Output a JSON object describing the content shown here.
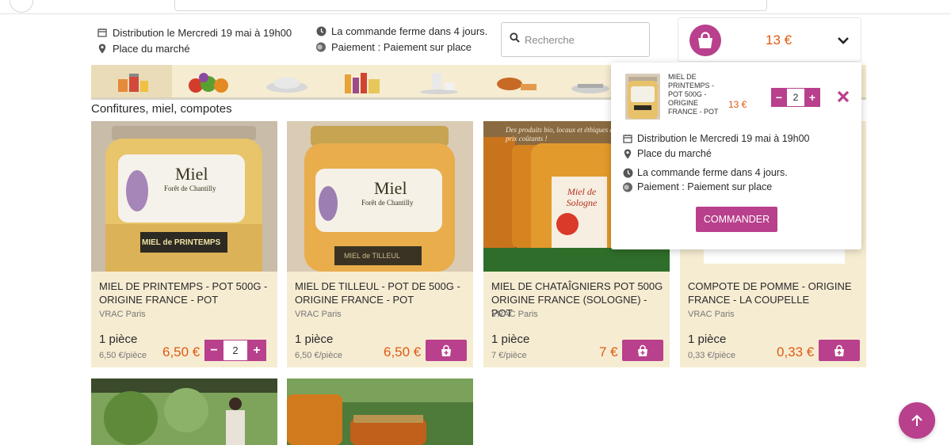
{
  "header": {
    "distribution": "Distribution le Mercredi 19 mai à 19h00",
    "place": "Place du marché",
    "closing": "La commande ferme dans 4 jours.",
    "payment": "Paiement : Paiement sur place"
  },
  "search": {
    "placeholder": "Recherche"
  },
  "cart": {
    "total": "13 €",
    "item": {
      "name": "MIEL DE PRINTEMPS - POT 500G - ORIGINE FRANCE - POT",
      "price": "13 €",
      "qty": "2"
    },
    "distribution": "Distribution le Mercredi 19 mai à 19h00",
    "place": "Place du marché",
    "closing": "La commande ferme dans 4 jours.",
    "payment": "Paiement : Paiement sur place",
    "order_label": "COMMANDER"
  },
  "categories": [
    {
      "icon": "jars-icon"
    },
    {
      "icon": "vegetables-icon"
    },
    {
      "icon": "dishes-icon"
    },
    {
      "icon": "bottles-icon"
    },
    {
      "icon": "dairy-icon"
    },
    {
      "icon": "bread-icon"
    },
    {
      "icon": "kitchen-icon"
    }
  ],
  "section_title": "Confitures, miel, compotes",
  "products": [
    {
      "name": "MIEL DE PRINTEMPS - POT 500G - ORIGINE FRANCE - POT",
      "vendor": "VRAC Paris",
      "unit": "1 pièce",
      "unit_price": "6,50 €/pièce",
      "price": "6,50 €",
      "qty": "2",
      "image_label": "Miel",
      "image_sub": "Forêt de Chantilly",
      "image_band": "MIEL de PRINTEMPS"
    },
    {
      "name": "MIEL DE TILLEUL - POT DE 500G - ORIGINE FRANCE - POT",
      "vendor": "VRAC Paris",
      "unit": "1 pièce",
      "unit_price": "6,50 €/pièce",
      "price": "6,50 €",
      "image_label": "Miel",
      "image_sub": "Forêt de Chantilly",
      "image_band": "MIEL de TILLEUL"
    },
    {
      "name": "MIEL DE CHATAÎGNIERS POT 500G ORIGINE FRANCE (SOLOGNE) - POT",
      "vendor": "VRAC Paris",
      "unit": "1 pièce",
      "unit_price": "7 €/pièce",
      "price": "7 €",
      "image_label": "Miel de Sologne",
      "image_tag": "Des produits bio, locaux et éthiques à prix coûtants !"
    },
    {
      "name": "COMPOTE DE POMME - ORIGINE FRANCE - LA COUPELLE",
      "vendor": "VRAC Paris",
      "unit": "1 pièce",
      "unit_price": "0,33 €/pièce",
      "price": "0,33 €"
    }
  ],
  "colors": {
    "accent": "#b8408c",
    "price": "#e05a10",
    "card_bg": "#f6ecd2"
  }
}
